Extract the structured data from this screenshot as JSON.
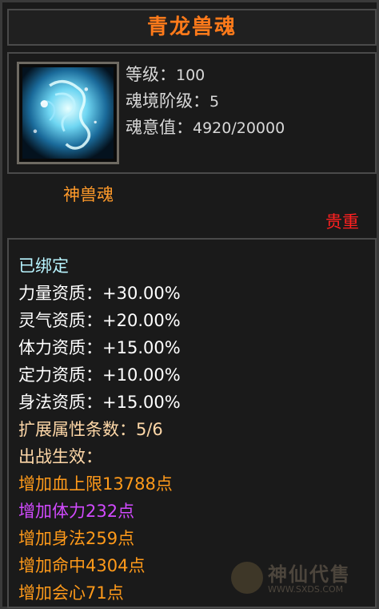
{
  "title": "青龙兽魂",
  "info": {
    "level_label": "等级：",
    "level_value": "100",
    "realm_label": "魂境阶级：",
    "realm_value": "5",
    "soul_label": "魂意值：",
    "soul_value": "4920/20000"
  },
  "category": "神兽魂",
  "quality": "贵重",
  "details": {
    "bound": "已绑定",
    "attributes": [
      {
        "label": "力量资质：",
        "value": "+30.00%"
      },
      {
        "label": "灵气资质：",
        "value": "+20.00%"
      },
      {
        "label": "体力资质：",
        "value": "+15.00%"
      },
      {
        "label": "定力资质：",
        "value": "+10.00%"
      },
      {
        "label": "身法资质：",
        "value": "+15.00%"
      }
    ],
    "ext_label": "扩展属性条数：",
    "ext_value": "5/6",
    "battle_label": "出战生效：",
    "effects": [
      {
        "text": "增加血上限13788点",
        "color": "#ff9a1a"
      },
      {
        "text": "增加体力232点",
        "color": "#d24aff"
      },
      {
        "text": "增加身法259点",
        "color": "#ff9a1a"
      },
      {
        "text": "增加命中4304点",
        "color": "#ff9a1a"
      },
      {
        "text": "增加会心71点",
        "color": "#ff9a1a"
      }
    ]
  },
  "watermark": {
    "text": "神仙代售",
    "url": "WWW.SXDS.COM"
  }
}
